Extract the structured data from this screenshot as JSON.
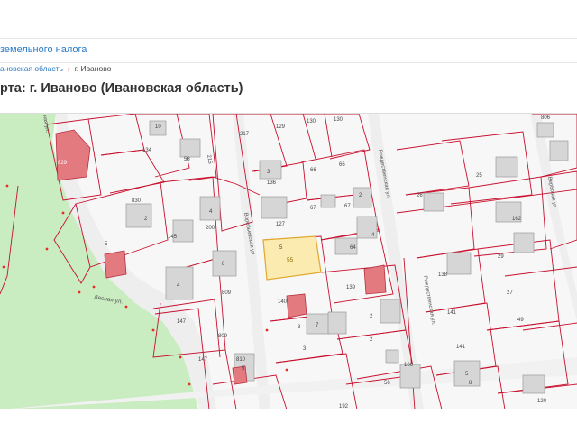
{
  "header": {
    "link_text": "земельного налога"
  },
  "breadcrumb": {
    "region": "ановская область",
    "city": "г. Иваново",
    "separator": "›"
  },
  "page": {
    "title": "рта: г. Иваново (Ивановская область)"
  },
  "map": {
    "highlighted_parcel": "55",
    "streets": [
      {
        "id": "lesnaya",
        "text": "Лесная ул."
      },
      {
        "id": "vorobyevskaya",
        "text": "Воробьевская ул."
      },
      {
        "id": "rozhdestvenskaya1",
        "text": "Рождественская ул."
      },
      {
        "id": "rozhdestvenskaya2",
        "text": "Рождественская ул."
      },
      {
        "id": "verbovaya",
        "text": "Вербовая ул."
      },
      {
        "id": "left-street",
        "text": "ная ул."
      }
    ],
    "labels": [
      {
        "id": "l10",
        "text": "10"
      },
      {
        "id": "l134",
        "text": "134"
      },
      {
        "id": "l58",
        "text": "58"
      },
      {
        "id": "l215",
        "text": "215"
      },
      {
        "id": "l217",
        "text": "217"
      },
      {
        "id": "l129",
        "text": "129"
      },
      {
        "id": "l130a",
        "text": "130"
      },
      {
        "id": "l130b",
        "text": "130"
      },
      {
        "id": "l829",
        "text": "829"
      },
      {
        "id": "l830",
        "text": "830"
      },
      {
        "id": "l2a",
        "text": "2"
      },
      {
        "id": "l3a",
        "text": "3"
      },
      {
        "id": "l136",
        "text": "136"
      },
      {
        "id": "l66a",
        "text": "66"
      },
      {
        "id": "l66b",
        "text": "66"
      },
      {
        "id": "l4a",
        "text": "4"
      },
      {
        "id": "l200",
        "text": "200"
      },
      {
        "id": "l145",
        "text": "145"
      },
      {
        "id": "l5a",
        "text": "5"
      },
      {
        "id": "l127",
        "text": "127"
      },
      {
        "id": "l67a",
        "text": "67"
      },
      {
        "id": "l67b",
        "text": "67"
      },
      {
        "id": "l2b",
        "text": "2"
      },
      {
        "id": "l4b",
        "text": "4"
      },
      {
        "id": "l64",
        "text": "64"
      },
      {
        "id": "l5b",
        "text": "5"
      },
      {
        "id": "l8",
        "text": "8"
      },
      {
        "id": "l4c",
        "text": "4"
      },
      {
        "id": "l809",
        "text": "809"
      },
      {
        "id": "l140",
        "text": "140"
      },
      {
        "id": "l139",
        "text": "139"
      },
      {
        "id": "l147a",
        "text": "147"
      },
      {
        "id": "l809b",
        "text": "809"
      },
      {
        "id": "l3b",
        "text": "3"
      },
      {
        "id": "l7",
        "text": "7"
      },
      {
        "id": "l3c",
        "text": "3"
      },
      {
        "id": "l2c",
        "text": "2"
      },
      {
        "id": "l2d",
        "text": "2"
      },
      {
        "id": "l147b",
        "text": "147"
      },
      {
        "id": "l810",
        "text": "810"
      },
      {
        "id": "l5c",
        "text": "5"
      },
      {
        "id": "l56",
        "text": "56"
      },
      {
        "id": "l106",
        "text": "106"
      },
      {
        "id": "l192",
        "text": "192"
      },
      {
        "id": "l806",
        "text": "806"
      },
      {
        "id": "l25",
        "text": "25"
      },
      {
        "id": "l26",
        "text": "26"
      },
      {
        "id": "l162",
        "text": "162"
      },
      {
        "id": "l29",
        "text": "29"
      },
      {
        "id": "l138",
        "text": "138"
      },
      {
        "id": "l27",
        "text": "27"
      },
      {
        "id": "l141a",
        "text": "141"
      },
      {
        "id": "l141b",
        "text": "141"
      },
      {
        "id": "l49",
        "text": "49"
      },
      {
        "id": "l8b",
        "text": "8"
      },
      {
        "id": "l120",
        "text": "120"
      },
      {
        "id": "l5d",
        "text": "5"
      }
    ]
  }
}
